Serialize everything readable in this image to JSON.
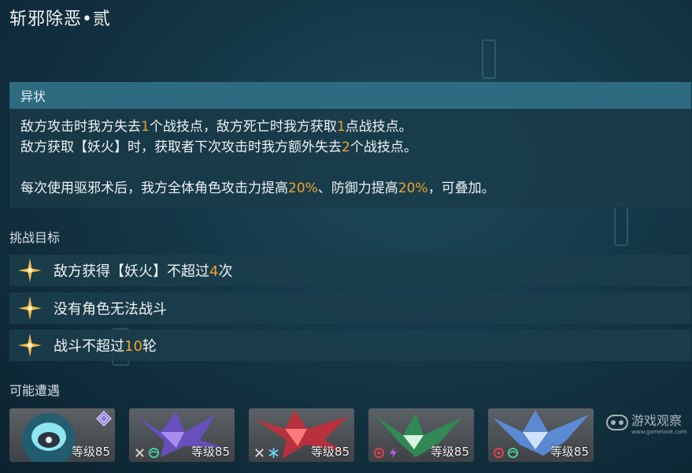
{
  "header": {
    "title": "斩邪除恶•贰"
  },
  "status": {
    "heading": "异状",
    "line1": {
      "a": "敌方攻击时我方失去",
      "b": "1",
      "c": "个战技点，敌方死亡时我方获取",
      "d": "1",
      "e": "点战技点。"
    },
    "line2": {
      "a": "敌方获取【妖火】时，获取者下次攻击时我方额外失去",
      "b": "2",
      "c": "个战技点。"
    },
    "line3": {
      "a": "每次使用驱邪术后，我方全体角色攻击力提高",
      "b": "20%",
      "c": "、防御力提高",
      "d": "20%",
      "e": "，可叠加。"
    }
  },
  "challenge": {
    "label": "挑战目标",
    "goals": [
      {
        "text": "敌方获得【妖火】不超过",
        "num": "4",
        "suffix": "次"
      },
      {
        "text": "没有角色无法战斗",
        "num": "",
        "suffix": ""
      },
      {
        "text": "战斗不超过",
        "num": "10",
        "suffix": "轮"
      }
    ]
  },
  "encounters": {
    "label": "可能遭遇",
    "enemies": [
      {
        "level": "等级85",
        "art_color": "#6fd3e6",
        "weaknesses": [],
        "badge": "elite-badge-icon"
      },
      {
        "level": "等级85",
        "art_color": "#7a5cd6",
        "weaknesses": [
          "physical-icon",
          "wind-icon"
        ]
      },
      {
        "level": "等级85",
        "art_color": "#d43a44",
        "weaknesses": [
          "physical-icon",
          "ice-icon"
        ]
      },
      {
        "level": "等级85",
        "art_color": "#3fae6a",
        "weaknesses": [
          "fire-icon",
          "lightning-icon"
        ]
      },
      {
        "level": "等级85",
        "art_color": "#6f9ee8",
        "weaknesses": [
          "fire-icon",
          "wind-icon"
        ]
      }
    ]
  },
  "watermark": {
    "title": "游戏观察",
    "sub": "www.gamelook.com"
  },
  "colors": {
    "highlight": "#f0a030",
    "status_head": "#2e6b80",
    "card_bg": "#1c3e4c"
  }
}
